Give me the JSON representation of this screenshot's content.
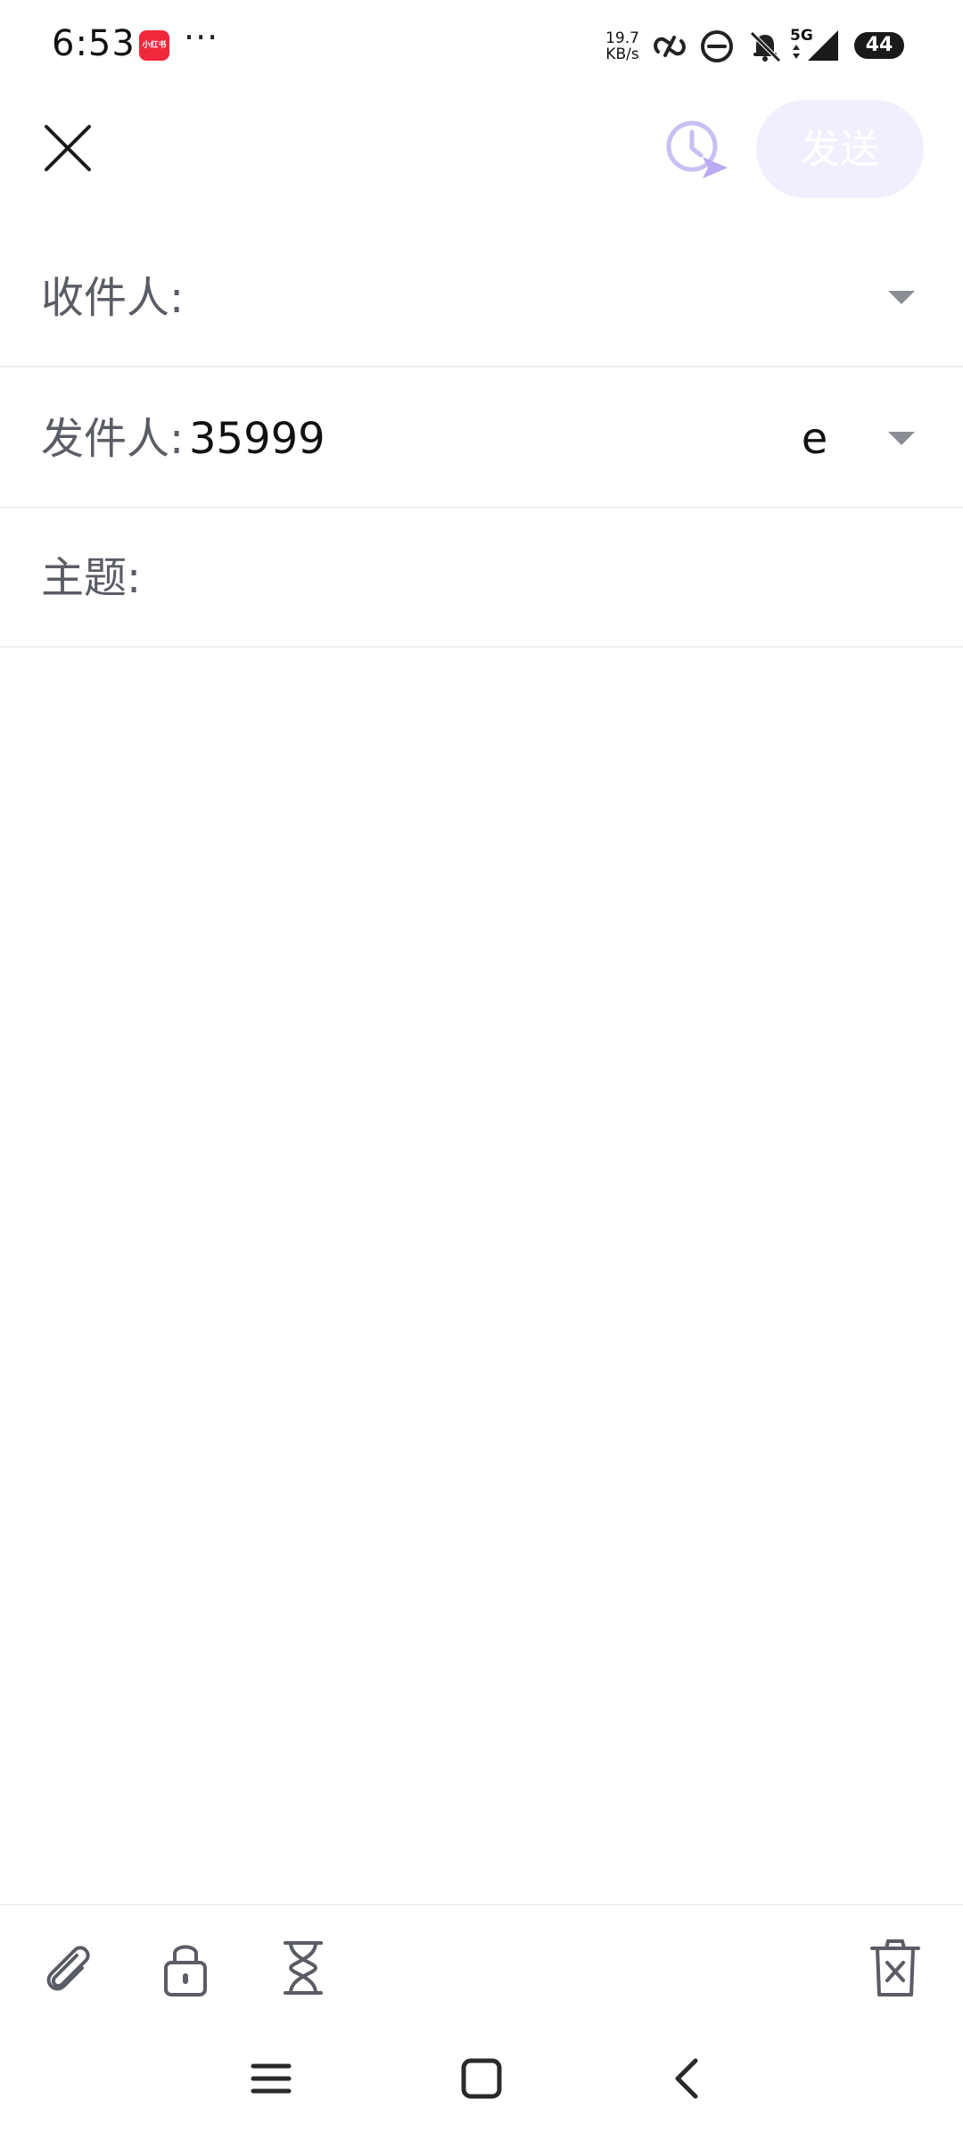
{
  "status_bar": {
    "time": "6:53",
    "app_badge": "小红书",
    "overflow": "···",
    "net_speed_value": "19.7",
    "net_speed_unit": "KB/s",
    "network": "5G",
    "battery": "44",
    "icons": [
      "hotspot-link-icon",
      "do-not-disturb-icon",
      "bell-off-icon",
      "cellular-signal-icon"
    ]
  },
  "top_bar": {
    "close_icon": "close-icon",
    "schedule_icon": "scheduled-send-icon",
    "send_label": "发送"
  },
  "form": {
    "to_label": "收件人:",
    "to_value": "",
    "from_label": "发件人:",
    "from_value": "35999                                   e",
    "subject_label": "主题:",
    "subject_value": "",
    "body_value": ""
  },
  "toolbar": {
    "items": [
      "attachment-icon",
      "encrypt-lock-icon",
      "expire-timer-icon",
      "delete-draft-icon"
    ]
  },
  "nav_bar": {
    "items": [
      "menu-icon",
      "home-icon",
      "back-icon"
    ]
  },
  "colors": {
    "accent": "#b8a9f0",
    "send_button_bg": "#f1effd",
    "label": "#5a5c66",
    "divider": "#efeff1"
  }
}
